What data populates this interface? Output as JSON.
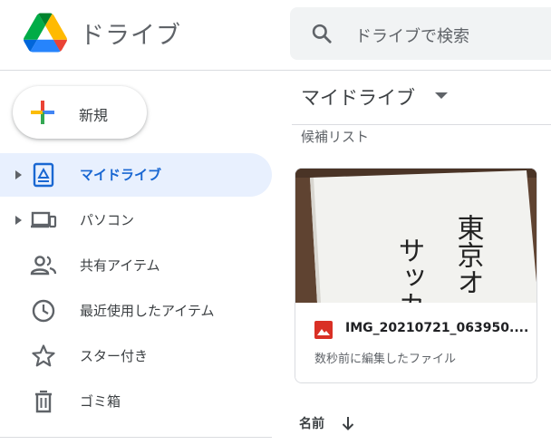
{
  "header": {
    "app_title": "ドライブ",
    "search_placeholder": "ドライブで検索"
  },
  "new_button": {
    "label": "新規"
  },
  "sidebar": {
    "items": [
      {
        "label": "マイドライブ",
        "icon": "my-drive-icon",
        "active": true,
        "expandable": true
      },
      {
        "label": "パソコン",
        "icon": "computers-icon",
        "active": false,
        "expandable": true
      },
      {
        "label": "共有アイテム",
        "icon": "shared-icon",
        "active": false,
        "expandable": false
      },
      {
        "label": "最近使用したアイテム",
        "icon": "clock-icon",
        "active": false,
        "expandable": false
      },
      {
        "label": "スター付き",
        "icon": "star-icon",
        "active": false,
        "expandable": false
      },
      {
        "label": "ゴミ箱",
        "icon": "trash-icon",
        "active": false,
        "expandable": false
      }
    ]
  },
  "main": {
    "title": "マイドライブ",
    "suggested_label": "候補リスト",
    "card": {
      "file_name": "IMG_20210721_063950....",
      "meta": "数秒前に編集したファイル",
      "thumb_text_right": "東京オ",
      "thumb_text_left": "サッカ"
    },
    "sort_label": "名前"
  },
  "colors": {
    "accent": "#1967d2",
    "active_bg": "#e8f0fe",
    "image_icon": "#d93025"
  }
}
